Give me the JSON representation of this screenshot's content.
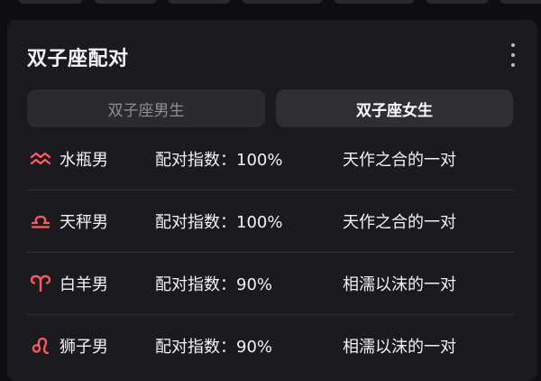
{
  "accent_color": "#ff5a5f",
  "card": {
    "title": "双子座配对",
    "more_icon": "more-vertical-icon"
  },
  "segments": {
    "male_label": "双子座男生",
    "female_label": "双子座女生",
    "selected": "female"
  },
  "matches": [
    {
      "icon": "aquarius-icon",
      "sign": "水瓶男",
      "score_label": "配对指数：100%",
      "score": 100,
      "desc": "天作之合的一对"
    },
    {
      "icon": "libra-icon",
      "sign": "天秤男",
      "score_label": "配对指数：100%",
      "score": 100,
      "desc": "天作之合的一对"
    },
    {
      "icon": "aries-icon",
      "sign": "白羊男",
      "score_label": "配对指数：90%",
      "score": 90,
      "desc": "相濡以沫的一对"
    },
    {
      "icon": "leo-icon",
      "sign": "狮子男",
      "score_label": "配对指数：90%",
      "score": 90,
      "desc": "相濡以沫的一对"
    }
  ]
}
